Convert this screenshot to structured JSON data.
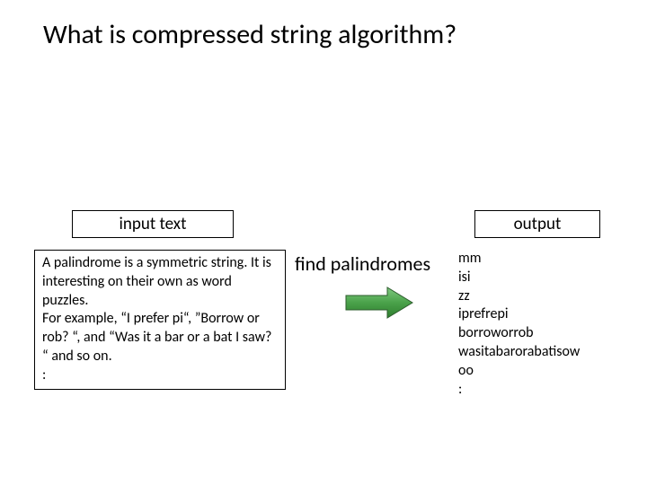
{
  "title": "What is compressed string algorithm?",
  "labels": {
    "input": "input  text",
    "output": "output",
    "find": "find palindromes"
  },
  "paragraph": "A palindrome is a symmetric string.  It is interesting on their own as word puzzles.\nFor example,  “I prefer pi“, ”Borrow or rob? “, and  “Was it a bar or a bat I saw? “ and so on.\n :",
  "output_items": [
    "mm",
    "isi",
    "zz",
    "iprefrepi",
    "borroworrob",
    "wasitabarorabatisow",
    "oo",
    " :"
  ]
}
